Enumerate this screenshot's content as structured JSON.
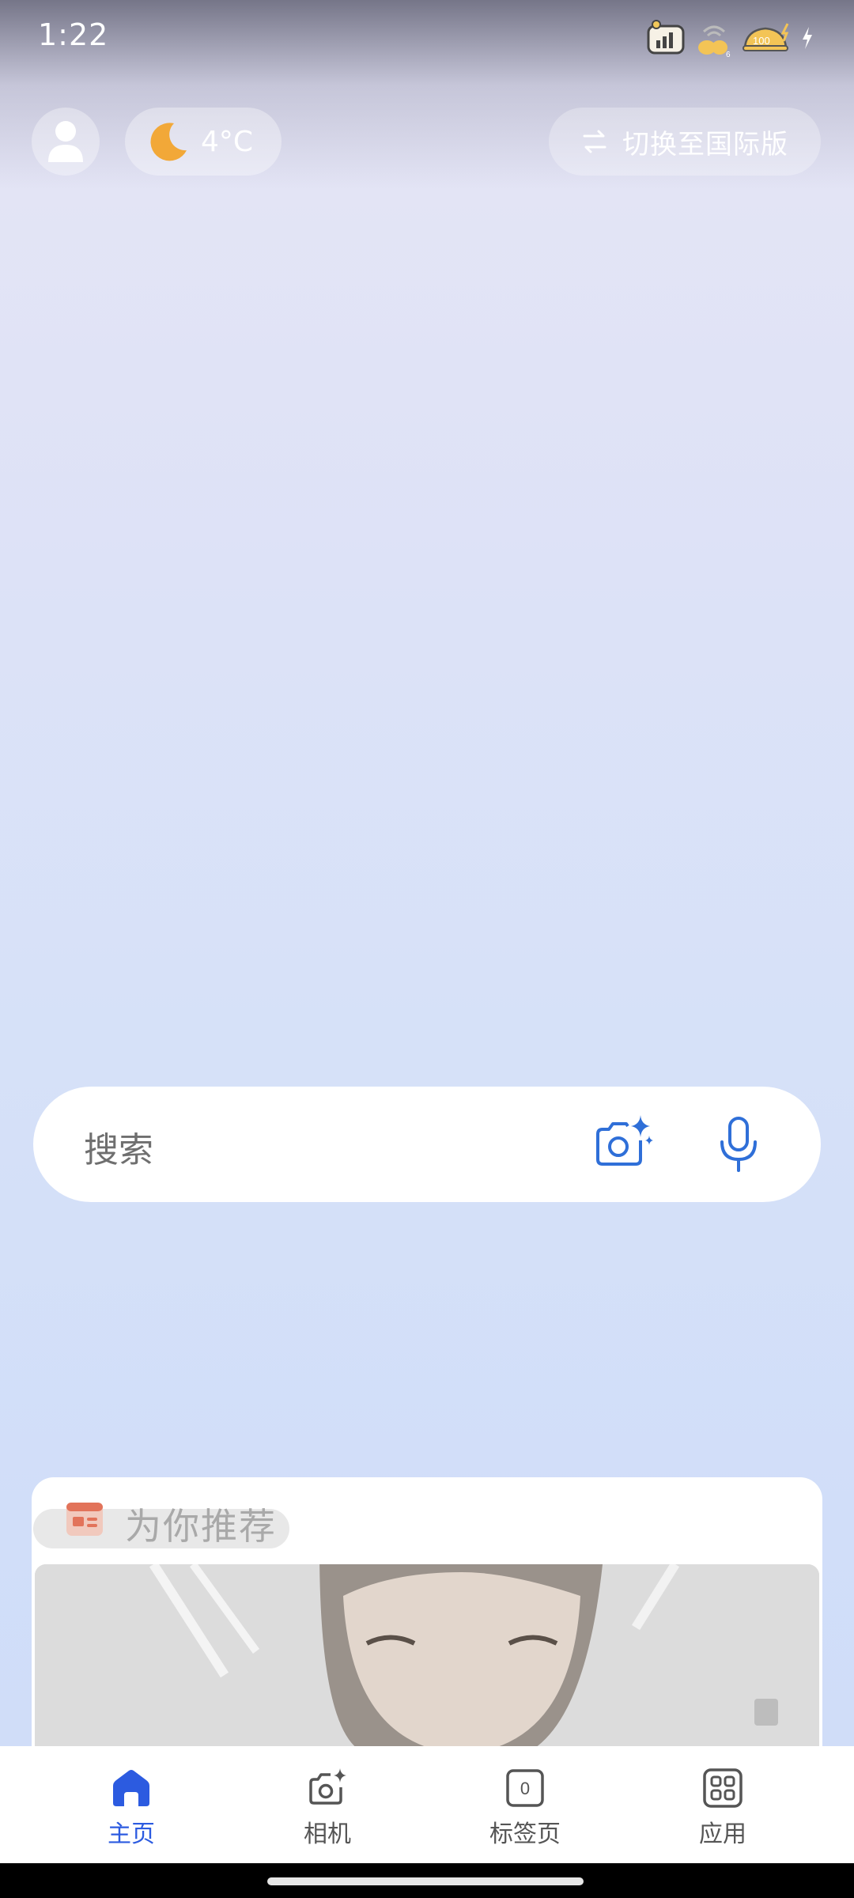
{
  "status_bar": {
    "time": "1:22",
    "battery_level": "100"
  },
  "top_bar": {
    "weather_temp": "4°C",
    "switch_label": "切换至国际版"
  },
  "search": {
    "placeholder": "搜索"
  },
  "recommendation": {
    "title": "为你推荐"
  },
  "bottom_nav": {
    "items": [
      {
        "label": "主页",
        "icon": "home-icon",
        "active": true
      },
      {
        "label": "相机",
        "icon": "camera-icon",
        "active": false
      },
      {
        "label": "标签页",
        "icon": "tabs-icon",
        "active": false,
        "count": "0"
      },
      {
        "label": "应用",
        "icon": "apps-grid-icon",
        "active": false
      }
    ]
  },
  "colors": {
    "accent": "#2c5be0",
    "search_icon_blue": "#2f6fd8",
    "moon": "#f2a838"
  }
}
